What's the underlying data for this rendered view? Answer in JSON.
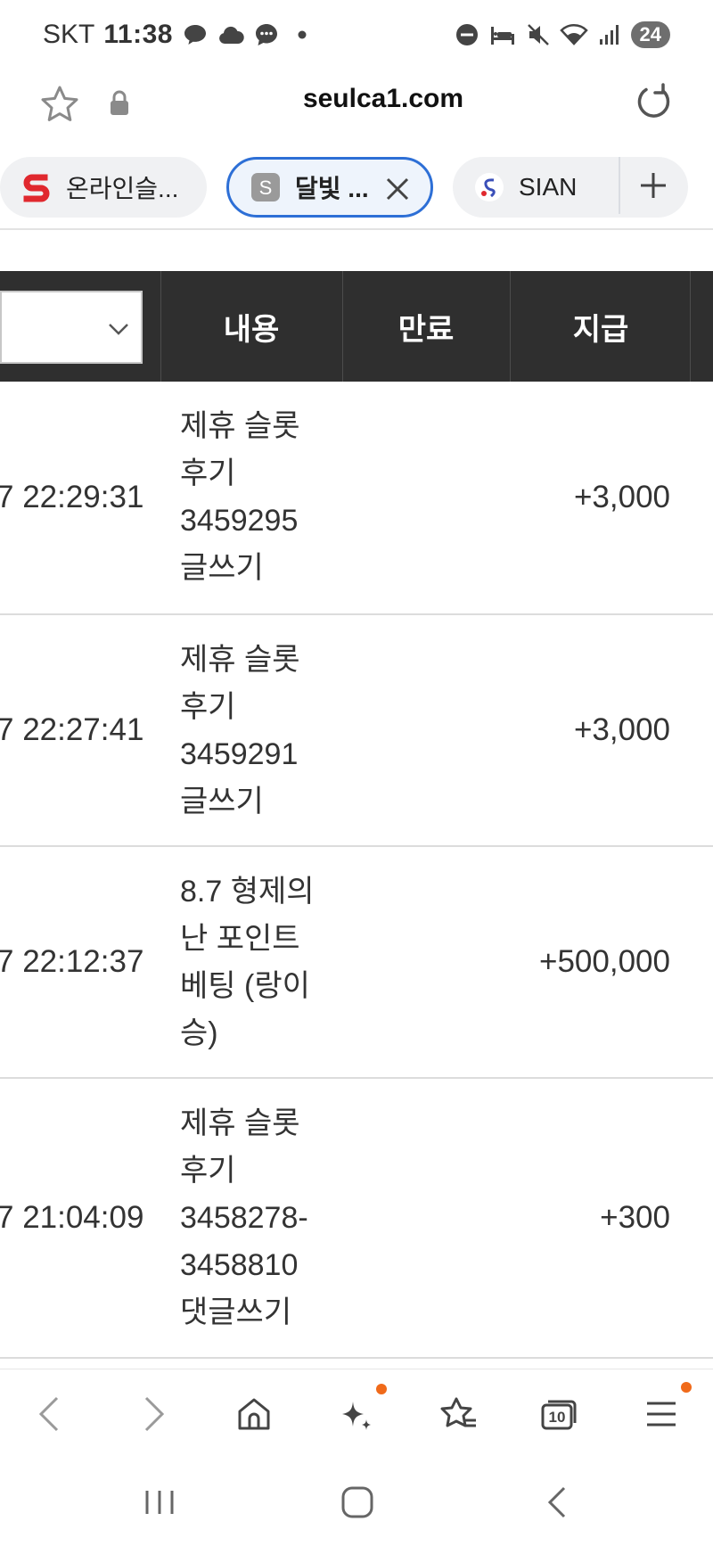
{
  "status_bar": {
    "carrier": "SKT",
    "time": "11:38",
    "battery": "24"
  },
  "browser": {
    "url": "seulca1.com",
    "tabs": [
      {
        "label": "온라인슬...",
        "favicon_letter": "S",
        "favicon_color": "#e0282e"
      },
      {
        "label": "달빛 ...",
        "favicon_letter": "S",
        "favicon_color": "#9a9a9a"
      },
      {
        "label": "SIAN",
        "favicon_letter": "S",
        "favicon_color": "#3a4fb8"
      }
    ]
  },
  "table": {
    "headers": {
      "content": "내용",
      "expire": "만료",
      "pay": "지급"
    },
    "rows": [
      {
        "date": "7 22:29:31",
        "content_lines": [
          "제휴 슬롯",
          "후기",
          "3459295",
          "글쓰기"
        ],
        "expire": "",
        "pay": "+3,000"
      },
      {
        "date": "7 22:27:41",
        "content_lines": [
          "제휴 슬롯",
          "후기",
          "3459291",
          "글쓰기"
        ],
        "expire": "",
        "pay": "+3,000"
      },
      {
        "date": "7 22:12:37",
        "content_lines": [
          "8.7 형제의",
          "난 포인트",
          "베팅 (랑이",
          "승)"
        ],
        "expire": "",
        "pay": "+500,000"
      },
      {
        "date": "7 21:04:09",
        "content_lines": [
          "제휴 슬롯",
          "후기",
          "3458278-",
          "3458810",
          "댓글쓰기"
        ],
        "expire": "",
        "pay": "+300"
      }
    ]
  },
  "bottom_nav": {
    "tabs_count": "10",
    "accent_color": "#f06a1a"
  }
}
